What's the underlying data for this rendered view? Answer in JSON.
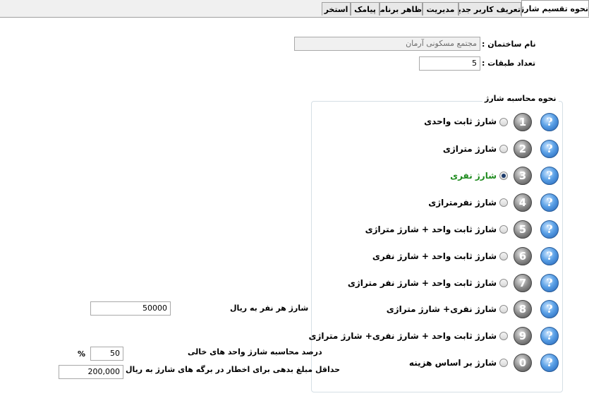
{
  "tabs": [
    {
      "label": "نحوه تقسیم شارژ",
      "active": true
    },
    {
      "label": "تعریف کاربر جدید",
      "active": false
    },
    {
      "label": "مدیریت",
      "active": false
    },
    {
      "label": "ظاهر برنامه",
      "active": false
    },
    {
      "label": "پیامک",
      "active": false
    },
    {
      "label": "استخر",
      "active": false
    }
  ],
  "building": {
    "name_label": "نام ساختمان :",
    "name_value": "مجتمع مسکونی آرمان",
    "floors_label": "تعداد طبقات :",
    "floors_value": "5"
  },
  "group_title": "نحوه محاسبه شارژ",
  "options": [
    {
      "number": "1",
      "label": "شارژ ثابت واحدی",
      "selected": false
    },
    {
      "number": "2",
      "label": "شارژ متراژی",
      "selected": false
    },
    {
      "number": "3",
      "label": "شارژ نفری",
      "selected": true
    },
    {
      "number": "4",
      "label": "شارژ نفرمتراژی",
      "selected": false
    },
    {
      "number": "5",
      "label": "شارژ ثابت واحد + شارژ متراژی",
      "selected": false
    },
    {
      "number": "6",
      "label": "شارژ ثابت واحد + شارژ نفری",
      "selected": false
    },
    {
      "number": "7",
      "label": "شارژ ثابت واحد + شارژ نفر متراژی",
      "selected": false
    },
    {
      "number": "8",
      "label": "شارژ نفری+ شارژ متراژی",
      "selected": false
    },
    {
      "number": "9",
      "label": "شارژ ثابت واحد + شارژ نفری+ شارژ متراژی",
      "selected": false
    },
    {
      "number": "0",
      "label": "شارژ بر اساس هزینه",
      "selected": false
    }
  ],
  "help_glyph": "?",
  "per_person": {
    "label": "شارژ هر نفر به ریال",
    "value": "50000"
  },
  "vacant": {
    "label": "درصد محاسبه شارژ واحد های خالی",
    "value": "50",
    "unit": "%"
  },
  "min_debt": {
    "label": "حداقل مبلغ بدهی برای اخطار در برگه های شارژ به ریال",
    "value": "200,000"
  },
  "colors": {
    "selected_option": "#1e8b1e",
    "help_icon": "#3a7fd5"
  }
}
